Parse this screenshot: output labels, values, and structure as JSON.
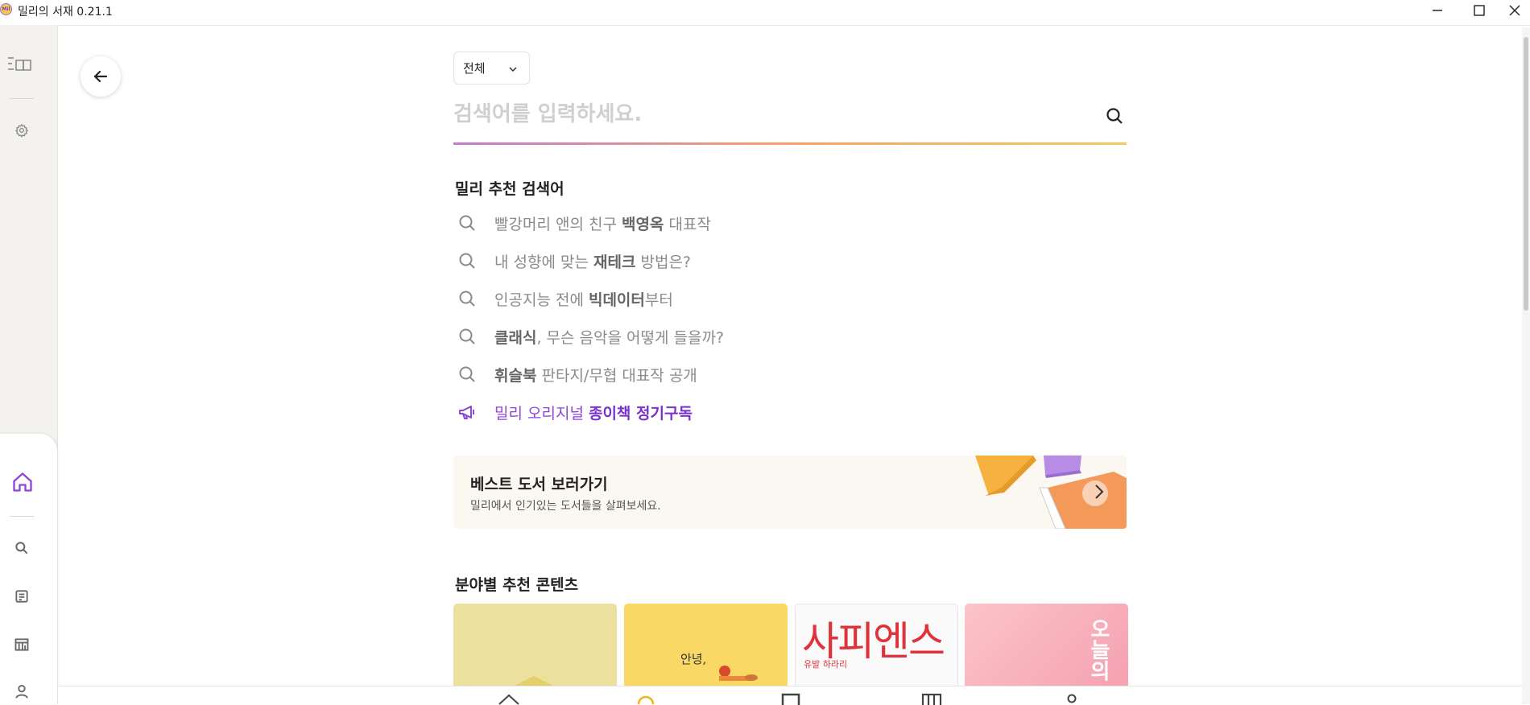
{
  "window": {
    "title": "밀리의 서재 0.21.1",
    "logo_text": "Mil",
    "minimize_icon": "minimize-icon",
    "maximize_icon": "maximize-icon",
    "close_icon": "close-icon"
  },
  "sidebar": {
    "top_icons": [
      "library-menu-icon",
      "gear-icon"
    ],
    "bottom_icons": [
      "home-icon",
      "search-icon",
      "post-icon",
      "store-icon",
      "profile-icon"
    ],
    "active_color": "#8e45d8"
  },
  "search": {
    "filter_label": "전체",
    "placeholder": "검색어를 입력하세요."
  },
  "recommendations": {
    "title": "밀리 추천 검색어",
    "items": [
      {
        "pre": "빨강머리 앤의 친구 ",
        "bold": "백영옥",
        "post": " 대표작"
      },
      {
        "pre": "내 성향에 맞는 ",
        "bold": "재테크",
        "post": " 방법은?"
      },
      {
        "pre": "인공지능 전에 ",
        "bold": "빅데이터",
        "post": "부터"
      },
      {
        "pre": "",
        "bold": "클래식",
        "post": ", 무슨 음악을 어떻게 들을까?"
      },
      {
        "pre": "",
        "bold": "휘슬북",
        "post": " 판타지/무협 대표작 공개"
      }
    ],
    "promo": {
      "pre": "밀리 오리지널 ",
      "bold": "종이책 정기구독",
      "icon": "megaphone-icon"
    }
  },
  "best_banner": {
    "title": "베스트 도서 보러가기",
    "subtitle": "밀리에서 인기있는 도서들을 살펴보세요."
  },
  "categories": {
    "title": "분야별 추천 콘텐츠",
    "cards": [
      {
        "text": ""
      },
      {
        "text": "안녕,"
      },
      {
        "text": "사피엔스",
        "subtext": "유발 하라리"
      },
      {
        "text": "오늘의"
      }
    ]
  },
  "colors": {
    "accent": "#8e45d8",
    "gradient_start": "#c779d0",
    "gradient_end": "#f6c85f"
  }
}
